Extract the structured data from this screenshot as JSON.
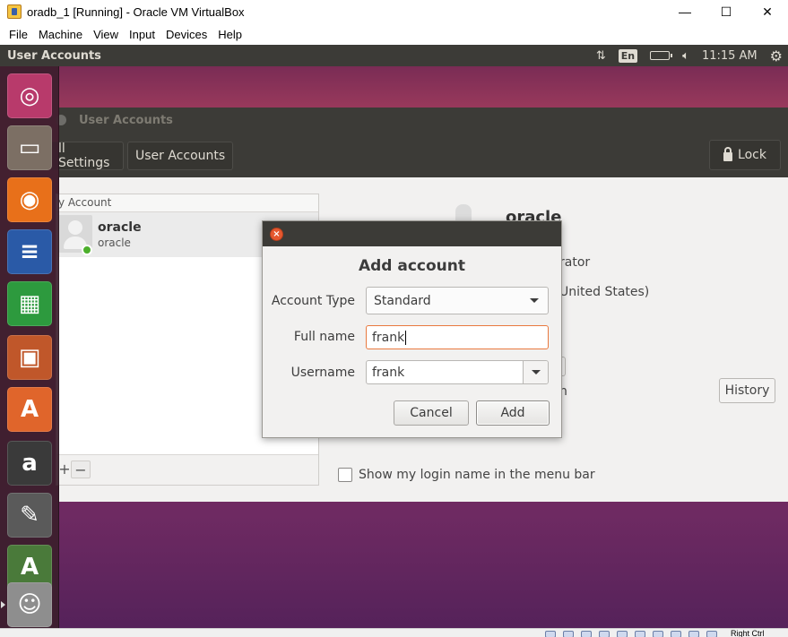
{
  "host_window": {
    "title": "oradb_1 [Running] - Oracle VM VirtualBox",
    "minimize_glyph": "—",
    "maximize_glyph": "☐",
    "close_glyph": "✕",
    "menu": [
      "File",
      "Machine",
      "View",
      "Input",
      "Devices",
      "Help"
    ]
  },
  "top_panel": {
    "app_title": "User Accounts",
    "keyboard_layout": "En",
    "time": "11:15 AM",
    "network_glyph": "⇅",
    "volume_glyph": "🔈︎",
    "gear_glyph": "⚙"
  },
  "launcher": {
    "items": [
      {
        "name": "ubuntu-dash-icon",
        "glyph": "◎",
        "color": "#b83a6b"
      },
      {
        "name": "files-icon",
        "glyph": "▭",
        "color": "#7c6f64"
      },
      {
        "name": "firefox-icon",
        "glyph": "◉",
        "color": "#e8701a"
      },
      {
        "name": "writer-icon",
        "glyph": "≡",
        "color": "#2a5aa7"
      },
      {
        "name": "calc-icon",
        "glyph": "▦",
        "color": "#2d9a3e"
      },
      {
        "name": "impress-icon",
        "glyph": "▣",
        "color": "#c0572a"
      },
      {
        "name": "software-center-icon",
        "glyph": "A",
        "color": "#e0652b"
      },
      {
        "name": "amazon-icon",
        "glyph": "a",
        "color": "#3a3a3a"
      },
      {
        "name": "system-settings-icon",
        "glyph": "✎",
        "color": "#5a5a5a"
      },
      {
        "name": "software-updater-icon",
        "glyph": "A",
        "color": "#4a7a3a"
      },
      {
        "name": "user-accounts-icon",
        "glyph": "☺",
        "color": "#8e8e8e"
      }
    ]
  },
  "user_accounts": {
    "window_title": "User Accounts",
    "breadcrumb_all_settings": "ll Settings",
    "breadcrumb_user_accounts": "User Accounts",
    "lock_label": "Lock",
    "list_header": "y Account",
    "user_name": "oracle",
    "user_login": "oracle",
    "add_glyph": "+",
    "remove_glyph": "−",
    "right_name": "oracle",
    "right_account_type": "rator",
    "right_language": "United States)",
    "right_last_login": "n",
    "history_label": "History",
    "login_name_checkbox": "Show my login name in the menu bar"
  },
  "dialog": {
    "heading": "Add account",
    "close_glyph": "×",
    "account_type_label": "Account Type",
    "account_type_value": "Standard",
    "full_name_label": "Full name",
    "full_name_value": "frank",
    "username_label": "Username",
    "username_value": "frank",
    "cancel_label": "Cancel",
    "add_label": "Add"
  },
  "vbox_status": {
    "host_key": "Right Ctrl"
  }
}
